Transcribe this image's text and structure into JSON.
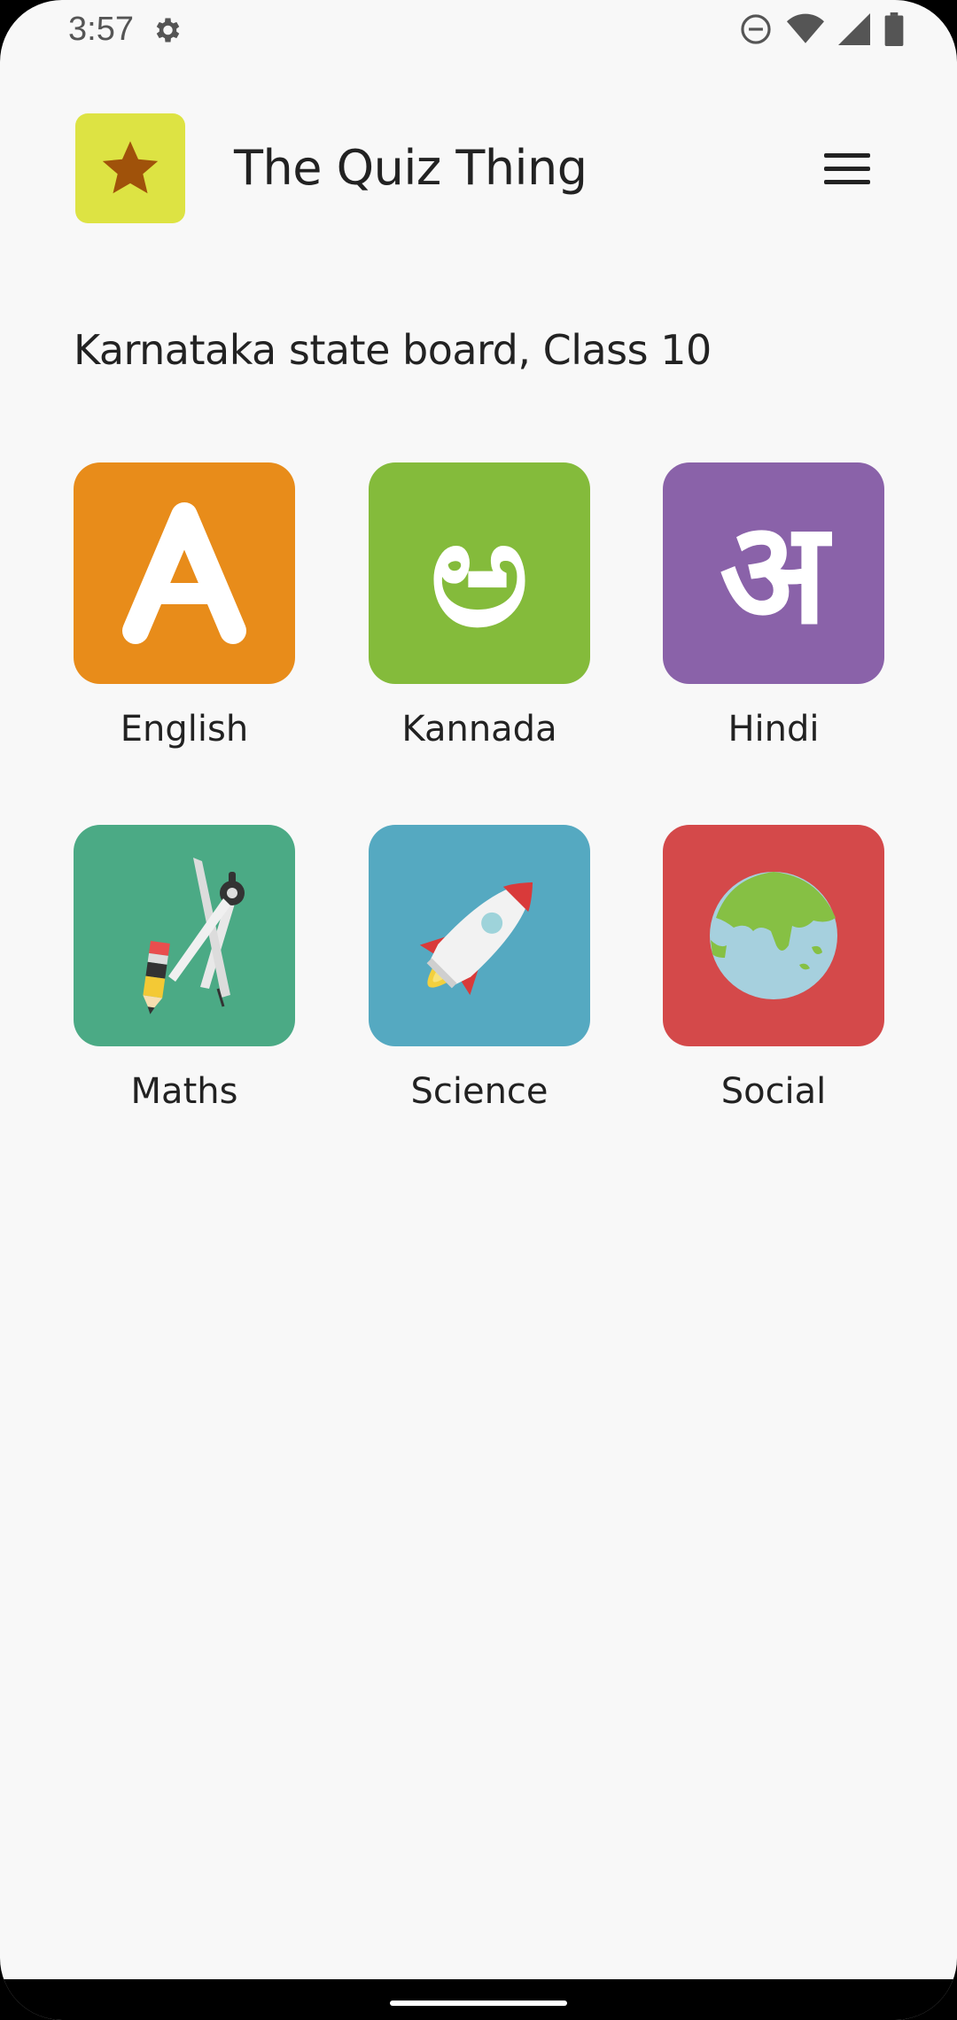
{
  "status_bar": {
    "time": "3:57",
    "icons": [
      "gear-icon",
      "dnd-icon",
      "wifi-icon",
      "signal-icon",
      "battery-icon"
    ]
  },
  "header": {
    "logo_icon": "star-icon",
    "title": "The Quiz Thing",
    "menu_icon": "hamburger-menu-icon"
  },
  "subtitle": "Karnataka state board, Class 10",
  "subjects": [
    {
      "label": "English",
      "color": "#e88c1a",
      "glyph": "A",
      "icon": "letter-a-icon"
    },
    {
      "label": "Kannada",
      "color": "#84bb3b",
      "glyph": "ಅ",
      "icon": "kannada-letter-icon"
    },
    {
      "label": "Hindi",
      "color": "#8a62a9",
      "glyph": "अ",
      "icon": "devanagari-letter-icon"
    },
    {
      "label": "Maths",
      "color": "#4baa85",
      "icon": "compass-pencil-icon"
    },
    {
      "label": "Science",
      "color": "#55a9c1",
      "icon": "rocket-icon"
    },
    {
      "label": "Social",
      "color": "#d4494a",
      "icon": "globe-icon"
    }
  ]
}
